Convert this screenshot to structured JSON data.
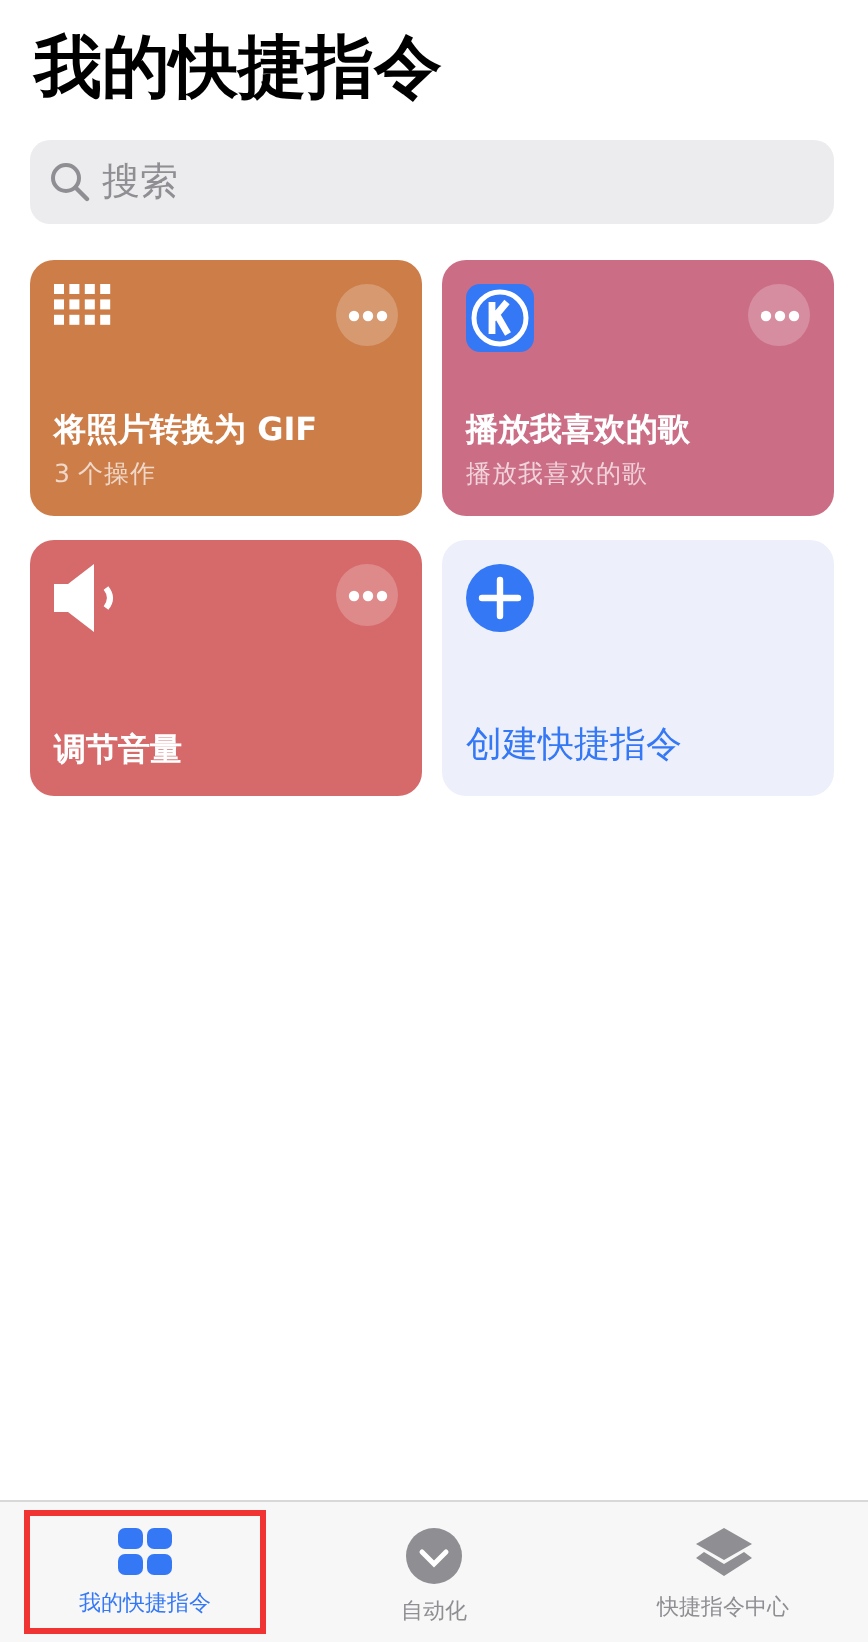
{
  "title": "我的快捷指令",
  "search": {
    "placeholder": "搜索"
  },
  "cards": [
    {
      "kind": "shortcut",
      "color": "#cc7d48",
      "title": "将照片转换为 GIF",
      "subtitle": "3 个操作"
    },
    {
      "kind": "shortcut",
      "color": "#cc6d86",
      "title": "播放我喜欢的歌",
      "subtitle": "播放我喜欢的歌"
    },
    {
      "kind": "shortcut",
      "color": "#d6696a",
      "title": "调节音量"
    },
    {
      "kind": "create",
      "title": "创建快捷指令"
    }
  ],
  "tabs": [
    {
      "label": "我的快捷指令",
      "selected": true,
      "highlighted": true
    },
    {
      "label": "自动化",
      "selected": false,
      "highlighted": false
    },
    {
      "label": "快捷指令中心",
      "selected": false,
      "highlighted": false
    }
  ]
}
